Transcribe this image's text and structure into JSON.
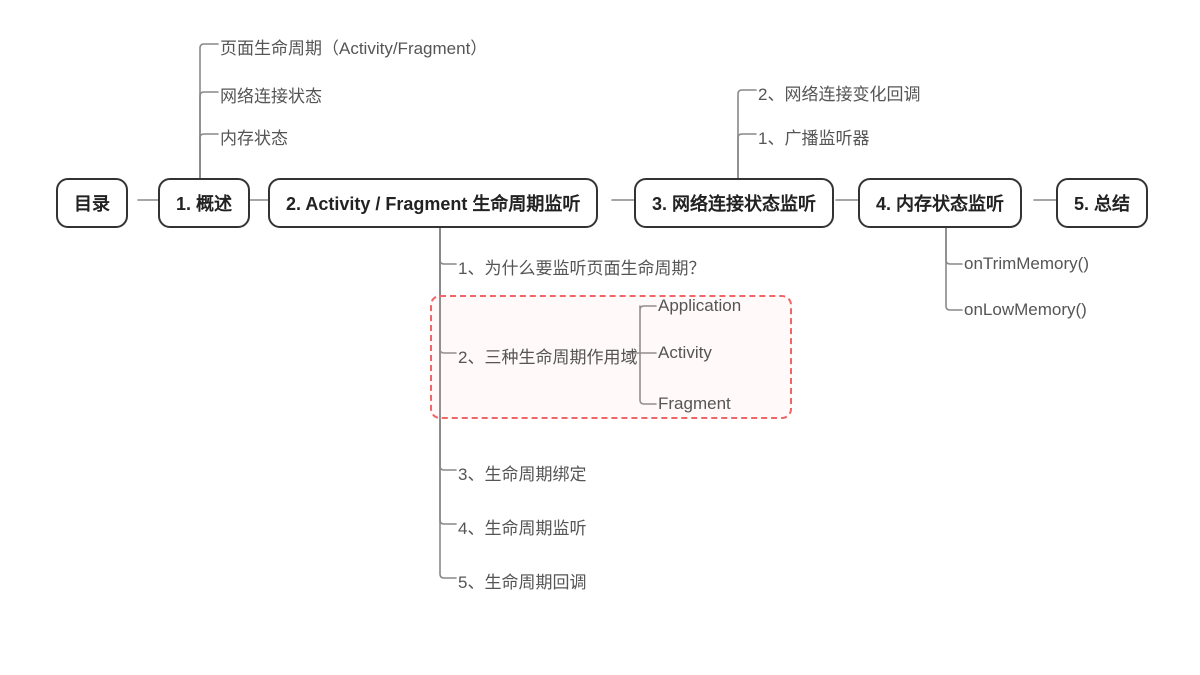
{
  "nodes": {
    "root": "目录",
    "n1": "1. 概述",
    "n2": "2. Activity / Fragment 生命周期监听",
    "n3": "3. 网络连接状态监听",
    "n4": "4. 内存状态监听",
    "n5": "5. 总结"
  },
  "n1_children": {
    "a": "页面生命周期（Activity/Fragment）",
    "b": "网络连接状态",
    "c": "内存状态"
  },
  "n2_children": {
    "a": "1、为什么要监听页面生命周期？",
    "b": "2、三种生命周期作用域",
    "c": "3、生命周期绑定",
    "d": "4、生命周期监听",
    "e": "5、生命周期回调"
  },
  "n2b_children": {
    "a": "Application",
    "b": "Activity",
    "c": "Fragment"
  },
  "n3_children": {
    "a": "2、网络连接变化回调",
    "b": "1、广播监听器"
  },
  "n4_children": {
    "a": "onTrimMemory()",
    "b": "onLowMemory()"
  }
}
